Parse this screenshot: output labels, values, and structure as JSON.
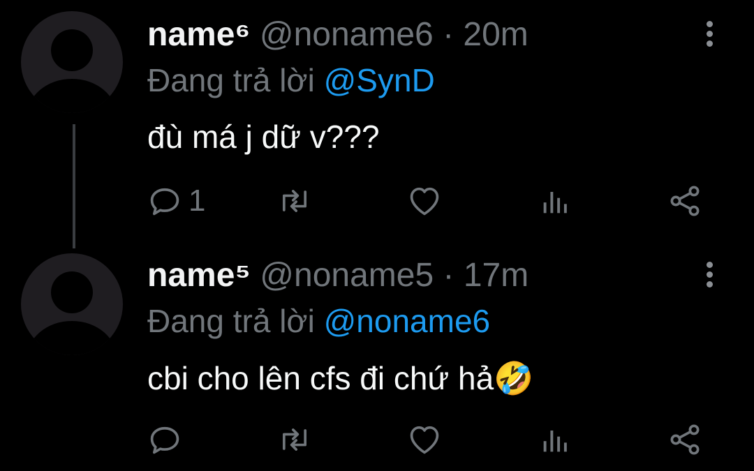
{
  "tweets": [
    {
      "display_name": "name⁶",
      "handle": "@noname6",
      "separator": "·",
      "time": "20m",
      "reply_prefix": "Đang trả lời",
      "reply_to": "@SynD",
      "text": "đù má j dữ v???",
      "emoji": "",
      "reply_count": "1"
    },
    {
      "display_name": "name⁵",
      "handle": "@noname5",
      "separator": "·",
      "time": "17m",
      "reply_prefix": "Đang trả lời",
      "reply_to": "@noname6",
      "text": "cbi cho lên cfs đi chứ hả",
      "emoji": "🤣",
      "reply_count": ""
    }
  ],
  "icons": {
    "reply": "reply-icon",
    "retweet": "retweet-icon",
    "like": "heart-icon",
    "views": "views-icon",
    "share": "share-icon",
    "more": "more-vertical-icon"
  },
  "colors": {
    "background": "#000000",
    "text": "#f7f9f9",
    "muted": "#71767b",
    "link": "#1d9bf0",
    "avatar": "#1f1d21",
    "thread_line": "#3a3d41"
  }
}
